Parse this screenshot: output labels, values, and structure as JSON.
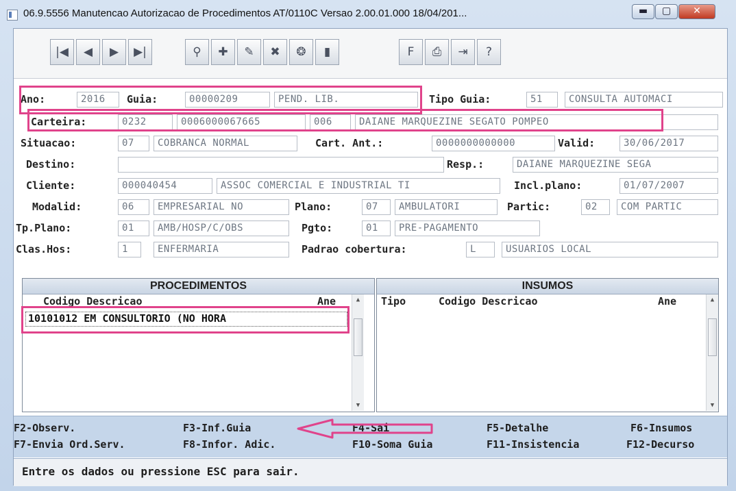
{
  "window": {
    "title": "06.9.5556 Manutencao Autorizacao de Procedimentos AT/0110C Versao 2.00.01.000 18/04/201...",
    "minimize": "▬",
    "maximize": "▢",
    "close": "✕"
  },
  "toolbar": {
    "buttons": [
      {
        "icon": "first-record-icon",
        "glyph": "|◀"
      },
      {
        "icon": "previous-record-icon",
        "glyph": "◀"
      },
      {
        "icon": "next-record-icon",
        "glyph": "▶"
      },
      {
        "icon": "last-record-icon",
        "glyph": "▶|"
      },
      {
        "icon": "search-icon",
        "glyph": "⚲"
      },
      {
        "icon": "add-record-icon",
        "glyph": "✚"
      },
      {
        "icon": "edit-record-icon",
        "glyph": "✎"
      },
      {
        "icon": "delete-record-icon",
        "glyph": "✖"
      },
      {
        "icon": "navigate-icon",
        "glyph": "❂"
      },
      {
        "icon": "exit-door-icon",
        "glyph": "▮"
      },
      {
        "icon": "filter-icon",
        "glyph": "F"
      },
      {
        "icon": "print-icon",
        "glyph": "⎙"
      },
      {
        "icon": "import-icon",
        "glyph": "⇥"
      },
      {
        "icon": "help-icon",
        "glyph": "?"
      }
    ]
  },
  "form": {
    "ano": {
      "label": "Ano:",
      "value": "2016"
    },
    "guia": {
      "label": "Guia:",
      "value": "00000209",
      "status": "PEND. LIB."
    },
    "tipo_guia": {
      "label": "Tipo Guia:",
      "code": "51",
      "desc": "CONSULTA AUTOMACI"
    },
    "carteira": {
      "label": "Carteira:",
      "part1": "0232",
      "part2": "0006000067665",
      "part3": "006",
      "name": "DAIANE MARQUEZINE SEGATO POMPEO"
    },
    "situacao": {
      "label": "Situacao:",
      "code": "07",
      "desc": "COBRANCA NORMAL"
    },
    "cart_ant": {
      "label": "Cart. Ant.:",
      "value": "0000000000000"
    },
    "valid": {
      "label": "Valid:",
      "value": "30/06/2017"
    },
    "destino": {
      "label": "Destino:",
      "value": ""
    },
    "resp": {
      "label": "Resp.:",
      "value": "DAIANE MARQUEZINE SEGA"
    },
    "cliente": {
      "label": "Cliente:",
      "code": "000040454",
      "desc": "ASSOC COMERCIAL E INDUSTRIAL TI"
    },
    "incl_plano": {
      "label": "Incl.plano:",
      "value": "01/07/2007"
    },
    "modalid": {
      "label": "Modalid:",
      "code": "06",
      "desc": "EMPRESARIAL NO"
    },
    "plano": {
      "label": "Plano:",
      "code": "07",
      "desc": "AMBULATORI"
    },
    "partic": {
      "label": "Partic:",
      "code": "02",
      "desc": "COM PARTIC"
    },
    "tp_plano": {
      "label": "Tp.Plano:",
      "code": "01",
      "desc": "AMB/HOSP/C/OBS"
    },
    "pgto": {
      "label": "Pgto:",
      "code": "01",
      "desc": "PRE-PAGAMENTO"
    },
    "clas_hos": {
      "label": "Clas.Hos:",
      "code": "1",
      "desc": "ENFERMARIA"
    },
    "padrao_cobertura": {
      "label": "Padrao cobertura:",
      "code": "L",
      "desc": "USUARIOS LOCAL"
    }
  },
  "procedimentos": {
    "title": "PROCEDIMENTOS",
    "col_codigo_descricao": "Codigo Descricao",
    "col_ane": "Ane",
    "rows": [
      {
        "text": "10101012 EM CONSULTORIO (NO HORA"
      }
    ]
  },
  "insumos": {
    "title": "INSUMOS",
    "col_tipo": "Tipo",
    "col_codigo_descricao": "Codigo Descricao",
    "col_ane": "Ane"
  },
  "function_keys": [
    "F2-Observ.",
    "F3-Inf.Guia",
    "F4-Sai",
    "F5-Detalhe",
    "F6-Insumos",
    "F7-Envia Ord.Serv.",
    "F8-Infor. Adic.",
    "F10-Soma Guia",
    "F11-Insistencia",
    "F12-Decurso"
  ],
  "status_message": "Entre os dados ou pressione ESC para sair.",
  "colors": {
    "highlight": "#e0438b",
    "window_frame": "#c9d8ea",
    "function_bar": "#c5d6ea"
  }
}
